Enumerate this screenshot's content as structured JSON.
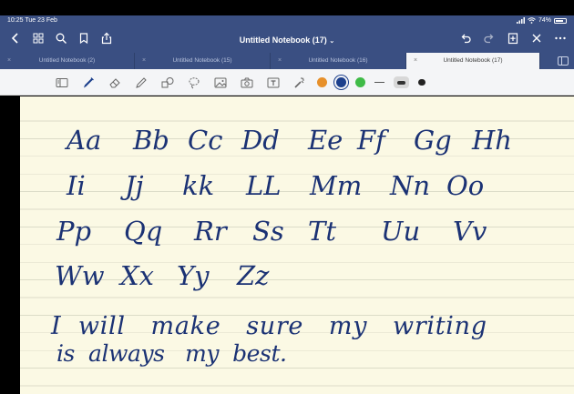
{
  "status_bar": {
    "time": "10:25  Tue 23 Feb",
    "battery": "74%"
  },
  "navbar": {
    "title": "Untitled Notebook (17)",
    "title_chevron": "⌄"
  },
  "tabs": [
    {
      "label": "Untitled Notebook (2)",
      "close": "×",
      "active": false
    },
    {
      "label": "Untitled Notebook (15)",
      "close": "×",
      "active": false
    },
    {
      "label": "Untitled Notebook (16)",
      "close": "×",
      "active": false
    },
    {
      "label": "Untitled Notebook (17)",
      "close": "×",
      "active": true
    }
  ],
  "toolbar": {
    "tools": [
      "read-mode-icon",
      "pen-icon",
      "eraser-icon",
      "highlighter-icon",
      "shapes-icon",
      "lasso-icon",
      "image-icon",
      "camera-icon",
      "text-box-icon",
      "laser-pointer-icon"
    ],
    "colors": [
      "#e7902a",
      "#1c3f8c",
      "#3fbb47"
    ],
    "selected_color": "#1c3f8c"
  },
  "handwriting": {
    "row1": [
      "Aa",
      "Bb",
      "Cc",
      "Dd",
      "Ee",
      "Ff",
      "Gg",
      "Hh"
    ],
    "row2": [
      "Ii",
      "Jj",
      "kk",
      "LL",
      "Mm",
      "Nn",
      "Oo"
    ],
    "row3": [
      "Pp",
      "Qq",
      "Rr",
      "Ss",
      "Tt",
      "Uu",
      "Vv"
    ],
    "row4": [
      "Ww",
      "Xx",
      "Yy",
      "Zz"
    ],
    "sentence_line1": "I  will   make   sure   my   writing",
    "sentence_line2": "is  always   my  best."
  },
  "ink_color": "#1b3274"
}
